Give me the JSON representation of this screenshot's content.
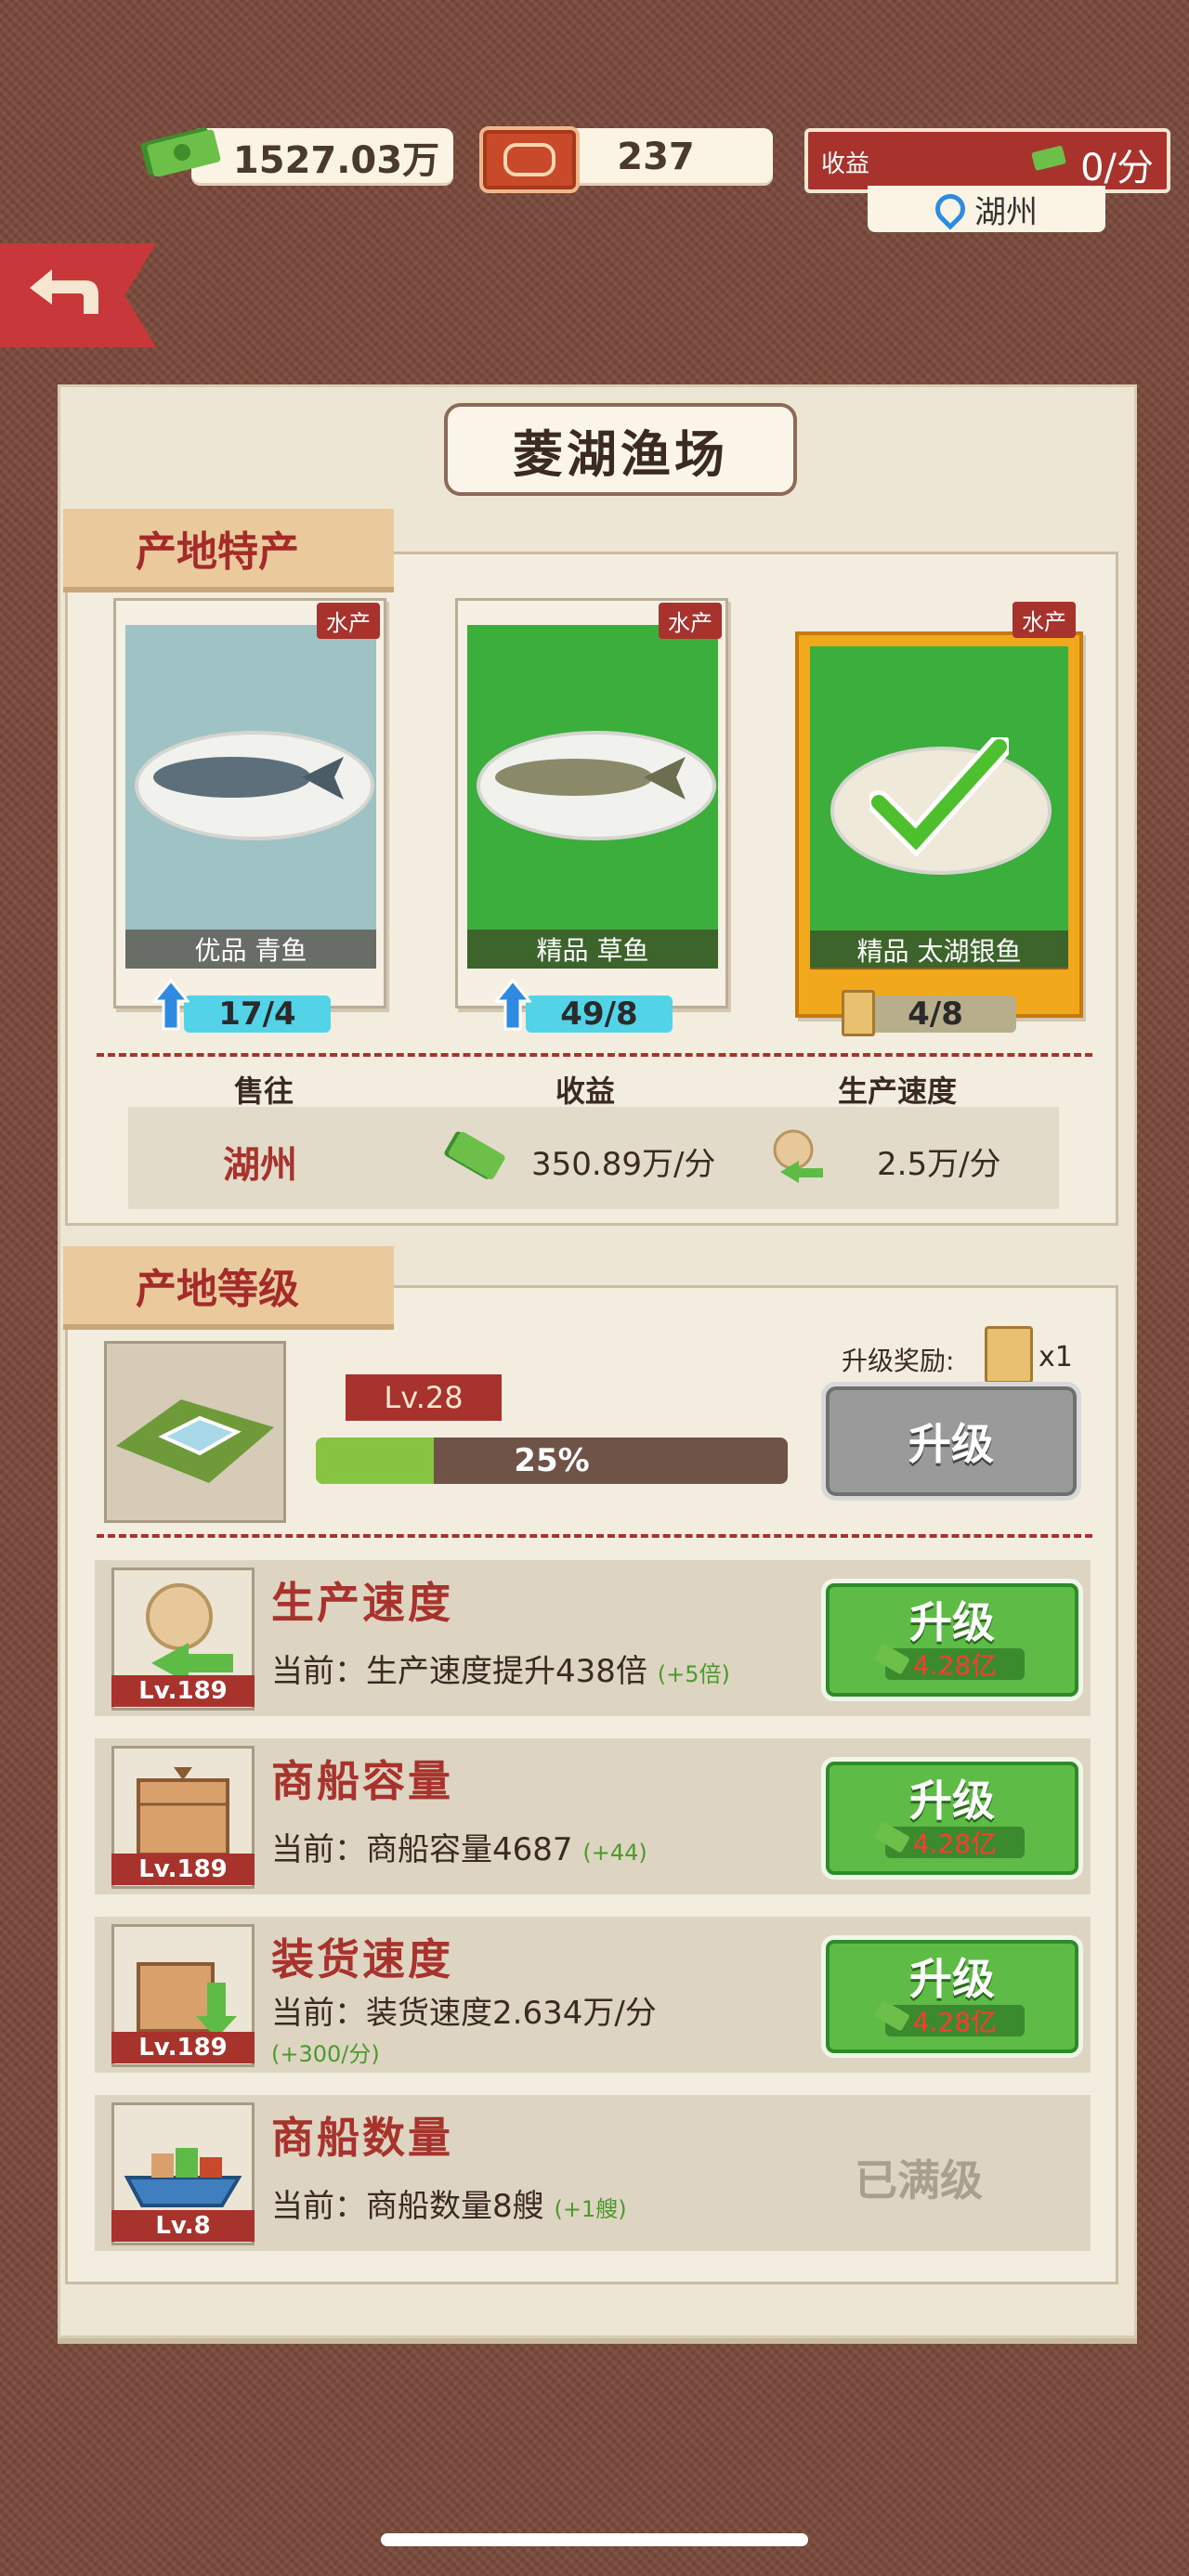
{
  "top_bar": {
    "money": "1527.03万",
    "tickets": "237",
    "income_label": "收益",
    "income_value": "0/分",
    "location": "湖州"
  },
  "panel": {
    "title": "菱湖渔场",
    "specialty_tab": "产地特产",
    "level_tab": "产地等级"
  },
  "products": [
    {
      "tag": "水产",
      "name": "优品 青鱼",
      "count": "17/4",
      "bg": "#9fc2c4"
    },
    {
      "tag": "水产",
      "name": "精品 草鱼",
      "count": "49/8",
      "bg": "#3cae3c"
    },
    {
      "tag": "水产",
      "name": "精品 太湖银鱼",
      "count": "4/8",
      "bg": "#3cae3c"
    }
  ],
  "stats": {
    "headers": [
      "售往",
      "收益",
      "生产速度"
    ],
    "destination": "湖州",
    "income": "350.89万/分",
    "speed": "2.5万/分"
  },
  "level": {
    "badge": "Lv.28",
    "progress_text": "25%",
    "progress": 0.25,
    "reward_label": "升级奖励:",
    "reward_count": "x1",
    "upgrade_label": "升级"
  },
  "upgrades": [
    {
      "title": "生产速度",
      "lv": "Lv.189",
      "desc": "当前：生产速度提升438倍",
      "bonus": "(+5倍)",
      "button": "升级",
      "cost": "4.28亿"
    },
    {
      "title": "商船容量",
      "lv": "Lv.189",
      "desc": "当前：商船容量4687",
      "bonus": "(+44)",
      "button": "升级",
      "cost": "4.28亿"
    },
    {
      "title": "装货速度",
      "lv": "Lv.189",
      "desc": "当前：装货速度2.634万/分",
      "bonus": "(+300/分)",
      "button": "升级",
      "cost": "4.28亿"
    },
    {
      "title": "商船数量",
      "lv": "Lv.8",
      "desc": "当前：商船数量8艘",
      "bonus": "(+1艘)",
      "maxed": "已满级"
    }
  ],
  "colors": {
    "accent_red": "#a8332d",
    "green_button": "#5dbb46",
    "background": "#7a4a3b"
  }
}
